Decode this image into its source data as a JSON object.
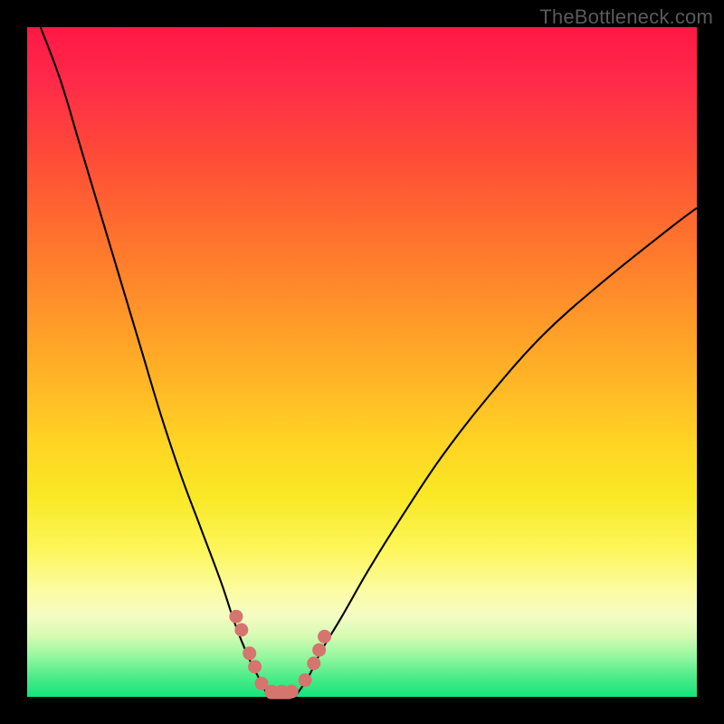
{
  "watermark": "TheBottleneck.com",
  "colors": {
    "background": "#000000",
    "curve": "#000000",
    "marker": "#d5756e",
    "gradient_top": "#ff1846",
    "gradient_bottom": "#14e37a"
  },
  "chart_data": {
    "type": "line",
    "title": "",
    "xlabel": "",
    "ylabel": "",
    "xlim": [
      0,
      100
    ],
    "ylim": [
      0,
      100
    ],
    "grid": false,
    "legend": false,
    "annotations": [
      "TheBottleneck.com"
    ],
    "series": [
      {
        "name": "left-curve",
        "x": [
          2,
          5,
          8,
          11,
          14,
          17,
          20,
          23,
          26,
          29,
          31,
          33,
          34.5,
          36
        ],
        "y": [
          100,
          92,
          82,
          72,
          62,
          52,
          42,
          33,
          25,
          17,
          11,
          6,
          3,
          0
        ]
      },
      {
        "name": "right-curve",
        "x": [
          40,
          42,
          44,
          47,
          51,
          56,
          62,
          69,
          77,
          86,
          96,
          100
        ],
        "y": [
          0,
          3,
          7,
          12,
          19,
          27,
          36,
          45,
          54,
          62,
          70,
          73
        ]
      }
    ],
    "markers": {
      "name": "highlighted-points",
      "x": [
        31.2,
        32.0,
        33.2,
        34.0,
        35.0,
        36.5,
        38.0,
        39.5,
        41.5,
        42.8,
        43.6,
        44.4
      ],
      "y": [
        12.0,
        10.0,
        6.5,
        4.5,
        2.0,
        0.8,
        0.8,
        0.8,
        2.5,
        5.0,
        7.0,
        9.0
      ]
    },
    "bottom_segment": {
      "name": "flat-minimum",
      "x_start": 35.5,
      "x_end": 40.0,
      "y": 0.6
    }
  }
}
